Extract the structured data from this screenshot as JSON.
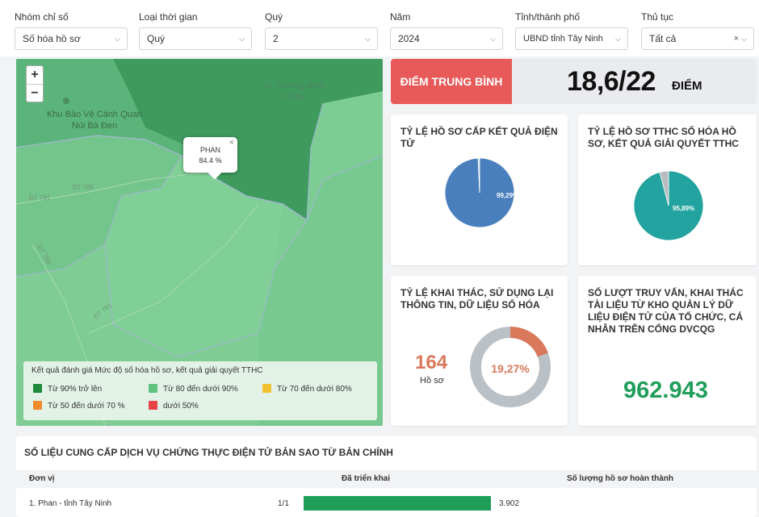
{
  "filters": [
    {
      "label": "Nhóm chỉ số",
      "value": "Số hóa hồ sơ"
    },
    {
      "label": "Loại thời gian",
      "value": "Quý"
    },
    {
      "label": "Quý",
      "value": "2"
    },
    {
      "label": "Năm",
      "value": "2024"
    },
    {
      "label": "Tỉnh/thành phố",
      "value": "UBND tỉnh Tây Ninh"
    },
    {
      "label": "Thủ tục",
      "value": "Tất cả"
    }
  ],
  "map": {
    "zoom_in": "+",
    "zoom_out": "−",
    "places": [
      "Khu Bảo Vệ Cảnh Quan Núi Bà Đen",
      "H. Dương Minh Châu"
    ],
    "roads": [
      "ĐT 785",
      "ĐT 781",
      "ĐT 790",
      "ĐT 781"
    ],
    "popup": {
      "name": "PHAN",
      "value": "84.4 %",
      "close": "×"
    },
    "legend": {
      "title": "Kết quả đánh giá Mức độ số hóa hồ sơ, kết quả giải quyết TTHC",
      "items": [
        {
          "label": "Từ 90% trở lên",
          "color": "#1e8a3c"
        },
        {
          "label": "Từ 80 đến dưới 90%",
          "color": "#5fc27e"
        },
        {
          "label": "Từ 70 đến dưới 80%",
          "color": "#f0c030"
        },
        {
          "label": "Từ 50 đến dưới 70 %",
          "color": "#f08a2c"
        },
        {
          "label": "dưới 50%",
          "color": "#e64545"
        }
      ]
    },
    "colors": {
      "dark": "#3f9a5e",
      "light": "#7ccc93"
    }
  },
  "score": {
    "label": "ĐIỂM TRUNG BÌNH",
    "value": "18,6/22",
    "unit": "ĐIỂM",
    "accent": "#e85a5a"
  },
  "cards": {
    "result_rate": {
      "title": "TỶ LỆ HỒ SƠ CẤP KẾT QUẢ ĐIỆN TỬ",
      "percent_label": "99,29%",
      "value": 99.29,
      "color": "#4a7fbd"
    },
    "digitized_rate": {
      "title": "TỶ LỆ HỒ SƠ TTHC SỐ HÓA HỒ SƠ, KẾT QUẢ GIẢI QUYẾT TTHC",
      "percent_label": "95,89%",
      "value": 95.89,
      "color": "#22a39f"
    },
    "reuse_rate": {
      "title": "TỶ LỆ KHAI THÁC, SỬ DỤNG LẠI THÔNG TIN, DỮ LIỆU SỐ HÓA",
      "count": "164",
      "count_unit": "Hồ sơ",
      "percent_label": "19,27%",
      "value": 19.27,
      "color": "#d9785a",
      "count_color": "#d9785a"
    },
    "lookups": {
      "title": "SỐ LƯỢT TRUY VẤN, KHAI THÁC TÀI LIỆU TỪ KHO QUẢN LÝ DỮ LIỆU ĐIỆN TỬ CỦA TỔ CHỨC, CÁ NHÂN TRÊN CỔNG DVCQG",
      "value": "962.943",
      "color": "#1f9e5a"
    }
  },
  "certification": {
    "title": "SỐ LIỆU CUNG CẤP DỊCH VỤ CHỨNG THỰC ĐIỆN TỬ BẢN SAO TỪ BẢN CHÍNH",
    "columns": [
      "Đơn vị",
      "Đã triển khai",
      "Số lượng hồ sơ hoàn thành"
    ],
    "rows": [
      {
        "unit": "1. Phan - tỉnh Tây Ninh",
        "deployed": "1/1",
        "deployed_fraction": 1.0,
        "completed": "3.902"
      }
    ]
  }
}
